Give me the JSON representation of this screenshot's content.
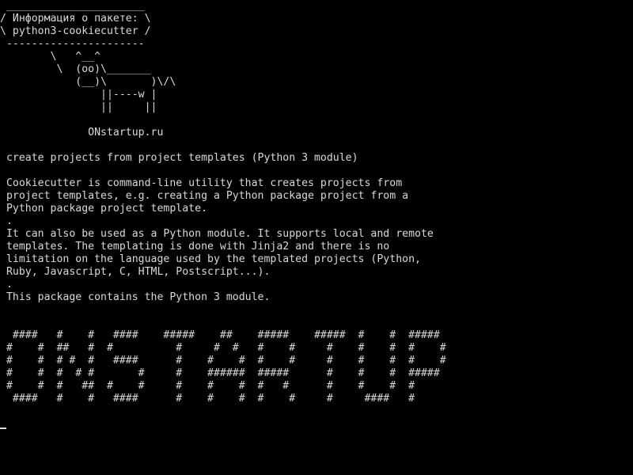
{
  "screen": {
    "background": "#000000",
    "foreground": "#d9d9d9",
    "lines": [
      " ______________________",
      "/ Информация о пакете: \\",
      "\\ python3-cookiecutter /",
      " ----------------------",
      "        \\   ^__^",
      "         \\  (oo)\\_______",
      "            (__)\\       )\\/\\",
      "                ||----w |",
      "                ||     ||",
      "",
      "              ONstartup.ru",
      "",
      " create projects from project templates (Python 3 module)",
      "",
      " Cookiecutter is command-line utility that creates projects from",
      " project templates, e.g. creating a Python package project from a",
      " Python package project template.",
      " .",
      " It can also be used as a Python module. It supports local and remote",
      " templates. The templating is done with Jinja2 and there is no",
      " limitation on the language used by the templated projects (Python,",
      " Ruby, Javascript, C, HTML, Postscript...).",
      " .",
      " This package contains the Python 3 module.",
      "",
      "",
      "  ####   #    #   ####    #####    ##    #####    #####  #    #  #####",
      " #    #  ##   #  #          #     #  #   #    #     #    #    #  #    #",
      " #    #  # #  #   ####      #    #    #  #    #     #    #    #  #    #",
      " #    #  #  # #       #     #    ######  #####      #    #    #  #####",
      " #    #  #   ##  #    #     #    #    #  #   #      #    #    #  #",
      "  ####   #    #   ####      #    #    #  #    #     #     ####   #"
    ]
  }
}
